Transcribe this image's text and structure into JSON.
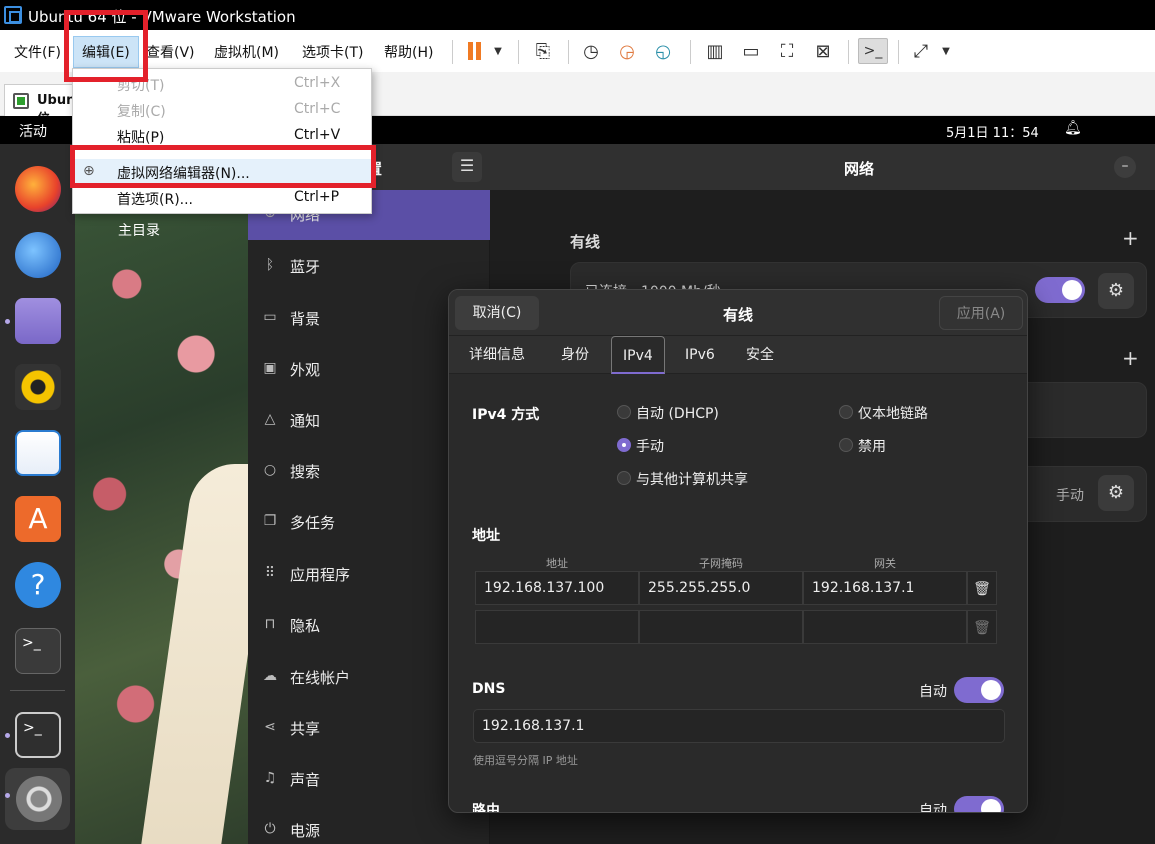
{
  "window": {
    "title": "Ubuntu 64 位 - VMware Workstation"
  },
  "menubar": {
    "items": [
      "文件(F)",
      "编辑(E)",
      "查看(V)",
      "虚拟机(M)",
      "选项卡(T)",
      "帮助(H)"
    ]
  },
  "tabs": {
    "vm_tab": "Ubuntu 64 位"
  },
  "edit_menu": {
    "items": [
      {
        "label": "剪切(T)",
        "shortcut": "Ctrl+X",
        "enabled": false
      },
      {
        "label": "复制(C)",
        "shortcut": "Ctrl+C",
        "enabled": false
      },
      {
        "label": "粘贴(P)",
        "shortcut": "Ctrl+V",
        "enabled": true
      },
      {
        "label": "虚拟网络编辑器(N)...",
        "shortcut": "",
        "enabled": true
      },
      {
        "label": "首选项(R)...",
        "shortcut": "Ctrl+P",
        "enabled": true
      }
    ]
  },
  "ubuntu_topbar": {
    "activities": "活动",
    "clock": "5月1日 11：54"
  },
  "desktop": {
    "home_folder": "主目录"
  },
  "settings": {
    "sidebar_title": "设置",
    "sidebar_items": [
      "网络",
      "蓝牙",
      "背景",
      "外观",
      "通知",
      "搜索",
      "多任务",
      "应用程序",
      "隐私",
      "在线帐户",
      "共享",
      "声音",
      "电源"
    ],
    "panel_title": "网络",
    "wired_section": "有线",
    "wired_status": "已连接 - 1000 Mb/秒",
    "proxy_mode": "手动"
  },
  "dialog": {
    "title": "有线",
    "cancel": "取消(C)",
    "apply": "应用(A)",
    "tabs": [
      "详细信息",
      "身份",
      "IPv4",
      "IPv6",
      "安全"
    ],
    "active_tab": "IPv4",
    "ipv4_method_label": "IPv4 方式",
    "methods": [
      {
        "label": "自动 (DHCP)",
        "selected": false
      },
      {
        "label": "仅本地链路",
        "selected": false
      },
      {
        "label": "手动",
        "selected": true
      },
      {
        "label": "禁用",
        "selected": false
      },
      {
        "label": "与其他计算机共享",
        "selected": false
      }
    ],
    "address_section": "地址",
    "columns": [
      "地址",
      "子网掩码",
      "网关"
    ],
    "rows": [
      [
        "192.168.137.100",
        "255.255.255.0",
        "192.168.137.1"
      ],
      [
        "",
        "",
        ""
      ]
    ],
    "dns_label": "DNS",
    "dns_auto_label": "自动",
    "dns_auto": true,
    "dns_value": "192.168.137.1",
    "dns_hint": "使用逗号分隔 IP 地址",
    "routes_label": "路由",
    "routes_auto_label": "自动",
    "routes_auto": true
  },
  "colors": {
    "accent": "#7f6bd0",
    "highlight": "#e3212b"
  }
}
